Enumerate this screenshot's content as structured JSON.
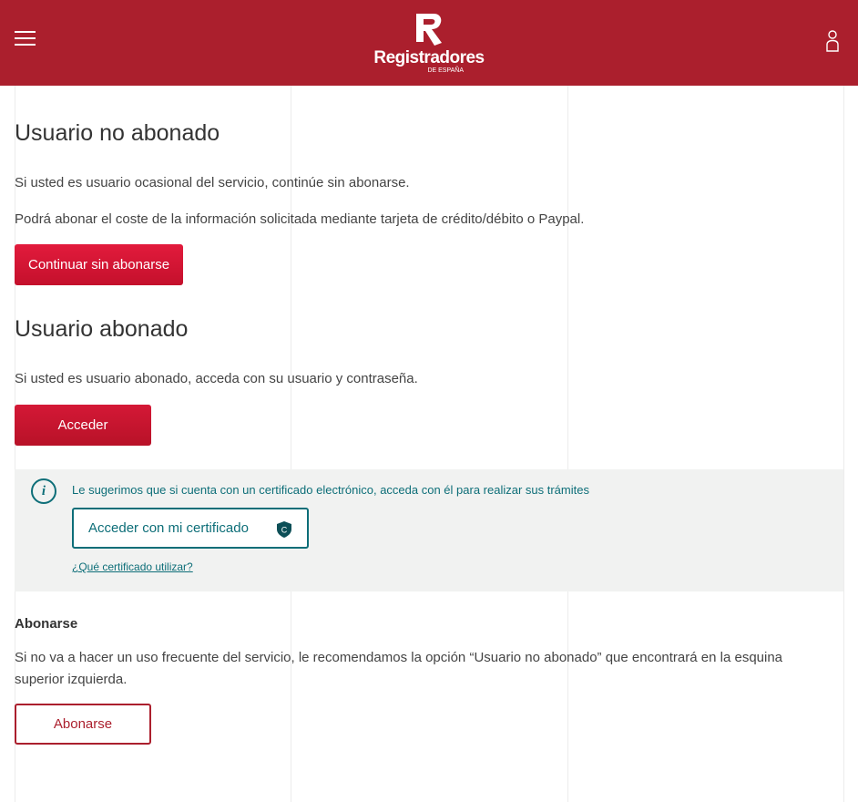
{
  "header": {
    "logo_text": "Registradores",
    "logo_sub": "DE ESPAÑA",
    "brand_color": "#ab1f2d",
    "menu_icon": "hamburger-icon",
    "user_icon": "user-icon"
  },
  "no_abonado": {
    "title": "Usuario no abonado",
    "text1": "Si usted es usuario ocasional del servicio, continúe sin abonarse.",
    "text2": "Podrá abonar el coste de la información solicitada mediante tarjeta de crédito/débito o Paypal.",
    "button": "Continuar sin abonarse"
  },
  "abonado": {
    "title": "Usuario abonado",
    "text": "Si usted es usuario abonado, acceda con su usuario y contraseña.",
    "button": "Acceder"
  },
  "certificate": {
    "hint": "Le sugerimos que si cuenta con un certificado electrónico, acceda con él para realizar sus trámites",
    "button": "Acceder con mi certificado",
    "shield_letter": "C",
    "link": "¿Qué certificado utilizar?",
    "accent_color": "#0d6e78"
  },
  "abonarse": {
    "title": "Abonarse",
    "text": "Si no va a hacer un uso frecuente del servicio, le recomendamos la opción “Usuario no abonado” que encontrará en la esquina superior izquierda.",
    "button": "Abonarse"
  }
}
